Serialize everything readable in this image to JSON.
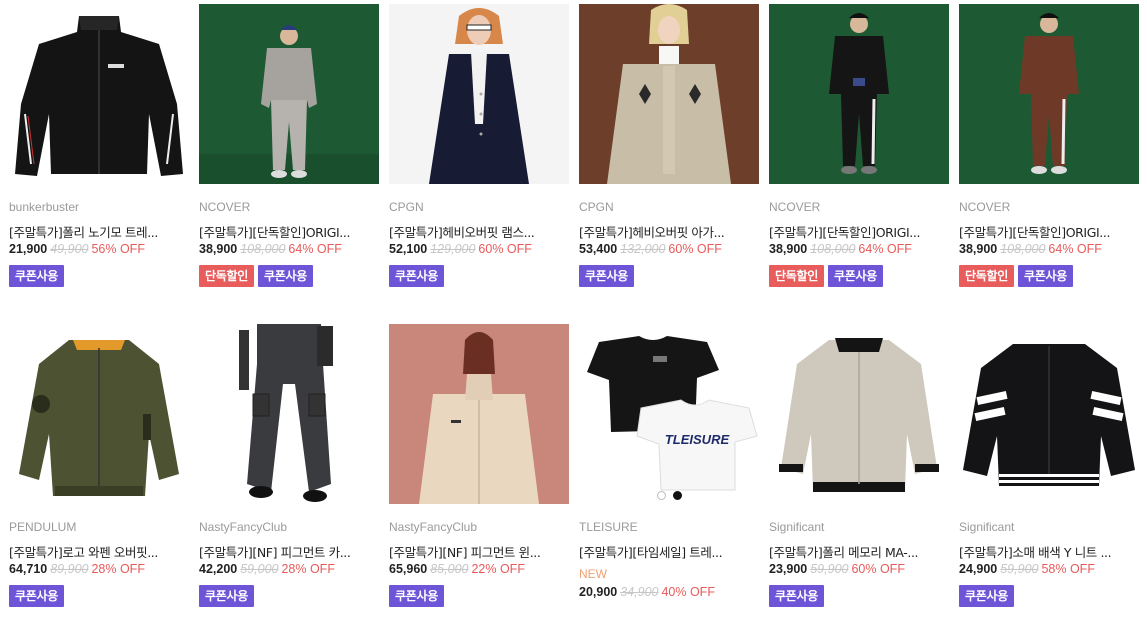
{
  "colors": {
    "coupon": "#6e55d8",
    "exclusive": "#e85c5c",
    "discount": "#e85a5a",
    "new": "#f0a070",
    "studio_green": "#1c5a32",
    "studio_brown": "#7a3f2c"
  },
  "products": [
    {
      "image": "black-track-jacket",
      "brand": "bunkerbuster",
      "name": "[주말특가]폴리 노기모 트레...",
      "price": "21,900",
      "original_price": "49,900",
      "discount": "56% OFF",
      "tags": [
        "쿠폰사용"
      ]
    },
    {
      "image": "grey-sweat-set-on-green",
      "brand": "NCOVER",
      "name": "[주말특가][단독할인]ORIGI...",
      "price": "38,900",
      "original_price": "108,000",
      "discount": "64% OFF",
      "tags": [
        "단독할인",
        "쿠폰사용"
      ]
    },
    {
      "image": "navy-cardigan-model",
      "brand": "CPGN",
      "name": "[주말특가]헤비오버핏 램스...",
      "price": "52,100",
      "original_price": "129,000",
      "discount": "60% OFF",
      "tags": [
        "쿠폰사용"
      ]
    },
    {
      "image": "beige-argyle-cardigan-model",
      "brand": "CPGN",
      "name": "[주말특가]헤비오버핏 아가...",
      "price": "53,400",
      "original_price": "132,000",
      "discount": "60% OFF",
      "tags": [
        "쿠폰사용"
      ]
    },
    {
      "image": "black-sweat-set-on-green",
      "brand": "NCOVER",
      "name": "[주말특가][단독할인]ORIGI...",
      "price": "38,900",
      "original_price": "108,000",
      "discount": "64% OFF",
      "tags": [
        "단독할인",
        "쿠폰사용"
      ]
    },
    {
      "image": "brown-sweat-set-on-green",
      "brand": "NCOVER",
      "name": "[주말특가][단독할인]ORIGI...",
      "price": "38,900",
      "original_price": "108,000",
      "discount": "64% OFF",
      "tags": [
        "단독할인",
        "쿠폰사용"
      ]
    },
    {
      "image": "khaki-ma1-jacket",
      "brand": "PENDULUM",
      "name": "[주말특가]로고 와펜 오버핏...",
      "price": "64,710",
      "original_price": "89,900",
      "discount": "28% OFF",
      "tags": [
        "쿠폰사용"
      ]
    },
    {
      "image": "grey-cargo-pants",
      "brand": "NastyFancyClub",
      "name": "[주말특가][NF] 피그먼트 카...",
      "price": "42,200",
      "original_price": "59,000",
      "discount": "28% OFF",
      "tags": [
        "쿠폰사용"
      ]
    },
    {
      "image": "beige-jacket-model",
      "brand": "NastyFancyClub",
      "name": "[주말특가][NF] 피그먼트 윈...",
      "price": "65,960",
      "original_price": "85,000",
      "discount": "22% OFF",
      "tags": [
        "쿠폰사용"
      ]
    },
    {
      "image": "tleisure-tshirts",
      "brand": "TLEISURE",
      "name": "[주말특가][타임세일] 트레...",
      "badge": "NEW",
      "price": "20,900",
      "original_price": "34,900",
      "discount": "40% OFF",
      "tags": [],
      "print": "TLEISURE"
    },
    {
      "image": "beige-ma1-jacket",
      "brand": "Significant",
      "name": "[주말특가]폴리 메모리 MA-...",
      "price": "23,900",
      "original_price": "59,900",
      "discount": "60% OFF",
      "tags": [
        "쿠폰사용"
      ]
    },
    {
      "image": "black-striped-cardigan",
      "brand": "Significant",
      "name": "[주말특가]소매 배색 Y 니트 ...",
      "price": "24,900",
      "original_price": "59,900",
      "discount": "58% OFF",
      "tags": [
        "쿠폰사용"
      ]
    }
  ]
}
